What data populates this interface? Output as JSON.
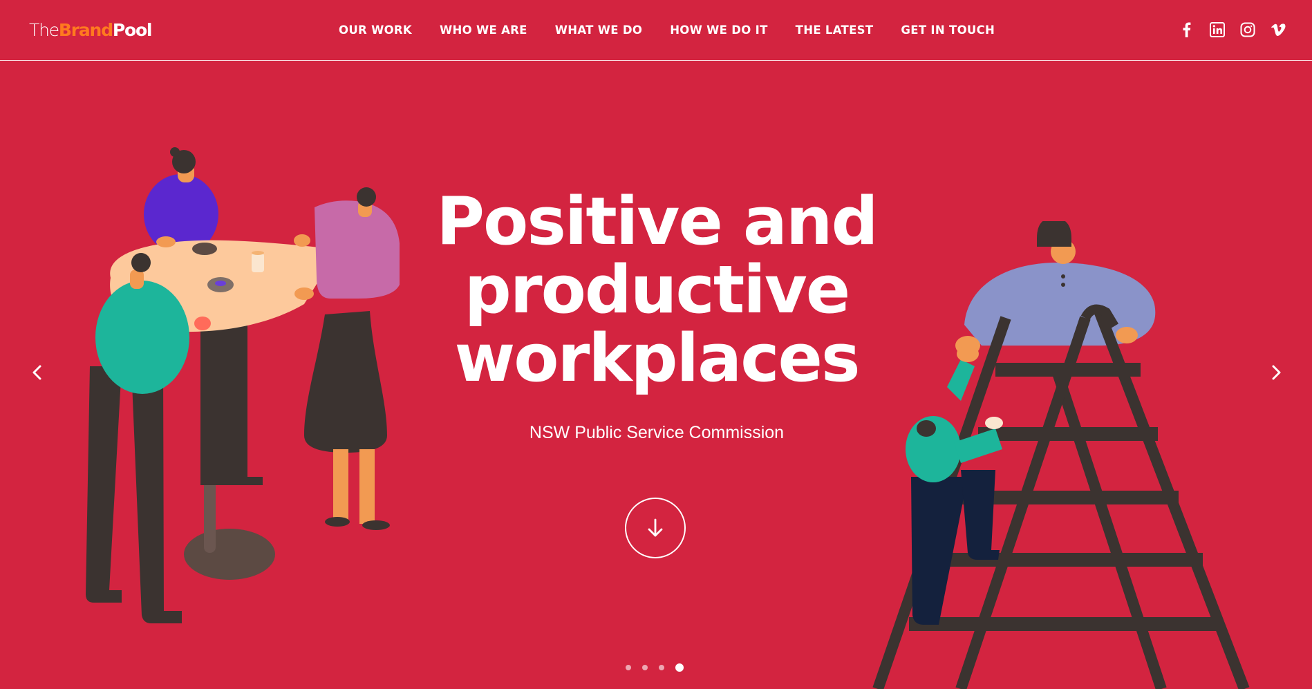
{
  "brand": {
    "logo_the": "The",
    "logo_brand": "Brand",
    "logo_pool": "Pool",
    "accent_color": "#ff7a1f",
    "background_color": "#d32440"
  },
  "nav": {
    "items": [
      {
        "label": "OUR WORK"
      },
      {
        "label": "WHO WE ARE"
      },
      {
        "label": "WHAT WE DO"
      },
      {
        "label": "HOW WE DO IT"
      },
      {
        "label": "THE LATEST"
      },
      {
        "label": "GET IN TOUCH"
      }
    ]
  },
  "social": {
    "icons": [
      "facebook-icon",
      "linkedin-icon",
      "instagram-icon",
      "vimeo-icon"
    ]
  },
  "hero": {
    "title_lines": [
      "Positive and",
      "productive",
      "workplaces"
    ],
    "subtitle": "NSW Public Service Commission",
    "scroll_icon": "arrow-down-icon",
    "prev_icon": "chevron-left-icon",
    "next_icon": "chevron-right-icon"
  },
  "slider": {
    "slide_count": 4,
    "active_slide": 4
  }
}
